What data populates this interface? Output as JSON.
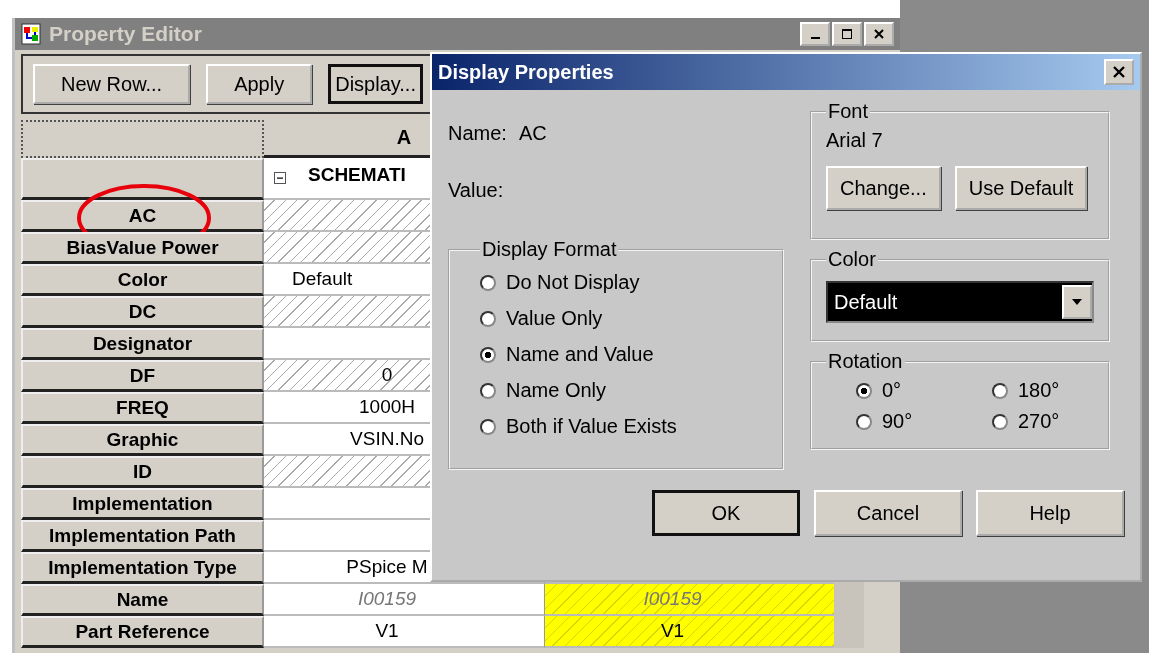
{
  "editor": {
    "title": "Property Editor",
    "toolbar": [
      {
        "label": "New Row...",
        "focused": false
      },
      {
        "label": "Apply",
        "focused": false
      },
      {
        "label": "Display...",
        "focused": true
      }
    ],
    "column_header": "A",
    "group": {
      "label": "SCHEMATI",
      "expanded": true
    },
    "rows": [
      {
        "label": "AC",
        "value": "",
        "hatched": true,
        "circled": true
      },
      {
        "label": "BiasValue Power",
        "value": "",
        "hatched": true,
        "circled": false
      },
      {
        "label": "Color",
        "value": "Default",
        "hatched": false,
        "circled": false,
        "kind": "choice"
      },
      {
        "label": "DC",
        "value": "",
        "hatched": true,
        "circled": false
      },
      {
        "label": "Designator",
        "value": "",
        "hatched": false,
        "circled": false
      },
      {
        "label": "DF",
        "value": "0",
        "hatched": true,
        "circled": false
      },
      {
        "label": "FREQ",
        "value": "1000H",
        "hatched": false,
        "circled": false
      },
      {
        "label": "Graphic",
        "value": "VSIN.No",
        "hatched": false,
        "circled": false
      },
      {
        "label": "ID",
        "value": "",
        "hatched": true,
        "circled": false
      },
      {
        "label": "Implementation",
        "value": "",
        "hatched": false,
        "circled": false
      },
      {
        "label": "Implementation Path",
        "value": "",
        "hatched": false,
        "circled": false
      },
      {
        "label": "Implementation Type",
        "value": "PSpice M",
        "hatched": false,
        "circled": false
      },
      {
        "label": "Name",
        "value": "I00159",
        "hatched": false,
        "circled": false,
        "italic": true,
        "value_b": "I00159"
      },
      {
        "label": "Part Reference",
        "value": "V1",
        "hatched": false,
        "circled": false,
        "value_b": "V1"
      }
    ]
  },
  "dialog": {
    "title": "Display Properties",
    "name_label": "Name:",
    "name_value": "AC",
    "value_label": "Value:",
    "display_format": {
      "title": "Display Format",
      "options": [
        {
          "label": "Do Not Display",
          "selected": false
        },
        {
          "label": "Value Only",
          "selected": false
        },
        {
          "label": "Name and Value",
          "selected": true
        },
        {
          "label": "Name Only",
          "selected": false
        },
        {
          "label": "Both if Value Exists",
          "selected": false
        }
      ]
    },
    "font": {
      "title": "Font",
      "current": "Arial 7",
      "buttons": [
        "Change...",
        "Use Default"
      ]
    },
    "color": {
      "title": "Color",
      "value": "Default"
    },
    "rotation": {
      "title": "Rotation",
      "options": [
        {
          "label": "0°",
          "selected": true
        },
        {
          "label": "180°",
          "selected": false
        },
        {
          "label": "90°",
          "selected": false
        },
        {
          "label": "270°",
          "selected": false
        }
      ]
    },
    "buttons": [
      {
        "label": "OK",
        "default": true
      },
      {
        "label": "Cancel",
        "default": false
      },
      {
        "label": "Help",
        "default": false
      }
    ]
  }
}
